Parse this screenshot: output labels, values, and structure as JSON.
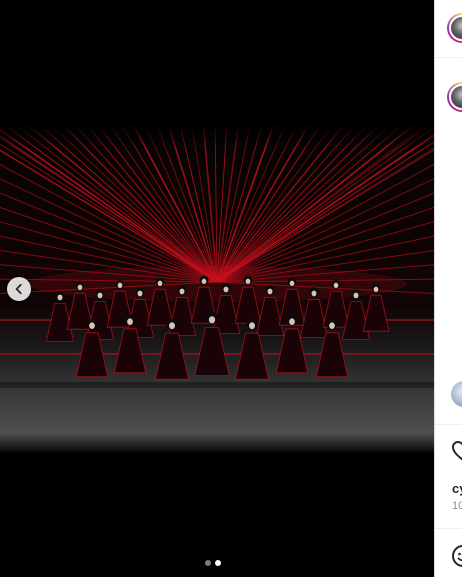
{
  "post": {
    "carousel": {
      "total_slides": 2,
      "current_slide": 2,
      "prev_icon": "chevron-left-icon"
    },
    "photo_subject": "stage-laser-dance-group",
    "colors": {
      "laser": "#c8101e",
      "background": "#000000",
      "panel": "#ffffff"
    }
  },
  "side": {
    "author_avatar": "avatar",
    "caption_avatar": "avatar",
    "comment_avatar": "avatar",
    "like_icon": "heart-icon",
    "emoji_icon": "emoji-icon",
    "username_fragment": "cy",
    "timestamp_fragment": "10"
  }
}
